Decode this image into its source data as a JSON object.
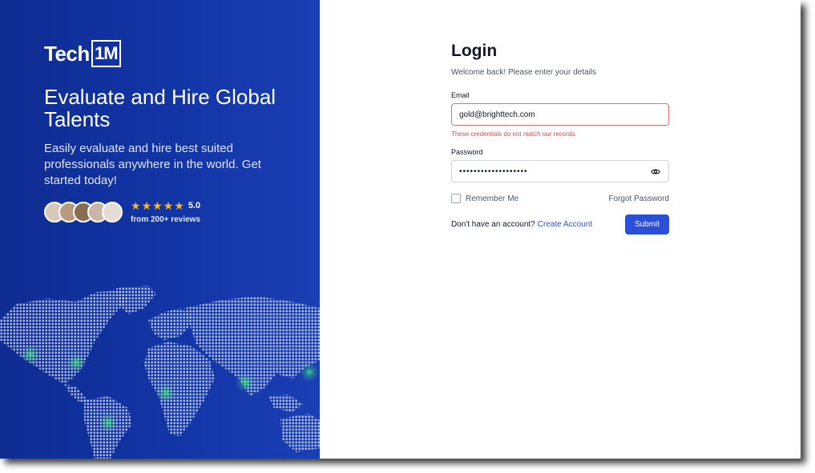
{
  "brand": {
    "name": "Tech",
    "badge": "1M"
  },
  "hero": {
    "headline": "Evaluate and Hire Global Talents",
    "subtext": "Easily evaluate and hire best suited professionals anywhere in the world. Get started today!",
    "rating": "5.0",
    "review_count": "from 200+ reviews",
    "avatar_colors": [
      "#d9c7b8",
      "#b89a7e",
      "#8a6c52",
      "#c9b4a8",
      "#e6dcd6"
    ],
    "star_color": "#f5b829"
  },
  "form": {
    "title": "Login",
    "welcome": "Welcome back! Please enter your details",
    "email_label": "Email",
    "email_value": "gold@brighttech.com",
    "error_message": "These credentials do not match our records.",
    "password_label": "Password",
    "password_value": "•••••••••••••••••••",
    "remember_label": "Remember Me",
    "forgot_label": "Forgot Password",
    "no_account_text": "Don't have an account?",
    "create_account_label": "Create Account",
    "submit_label": "Submit"
  },
  "colors": {
    "panel_blue": "#1235a6",
    "accent": "#2b4fd8",
    "error": "#e04848",
    "link": "#2f55d4"
  }
}
